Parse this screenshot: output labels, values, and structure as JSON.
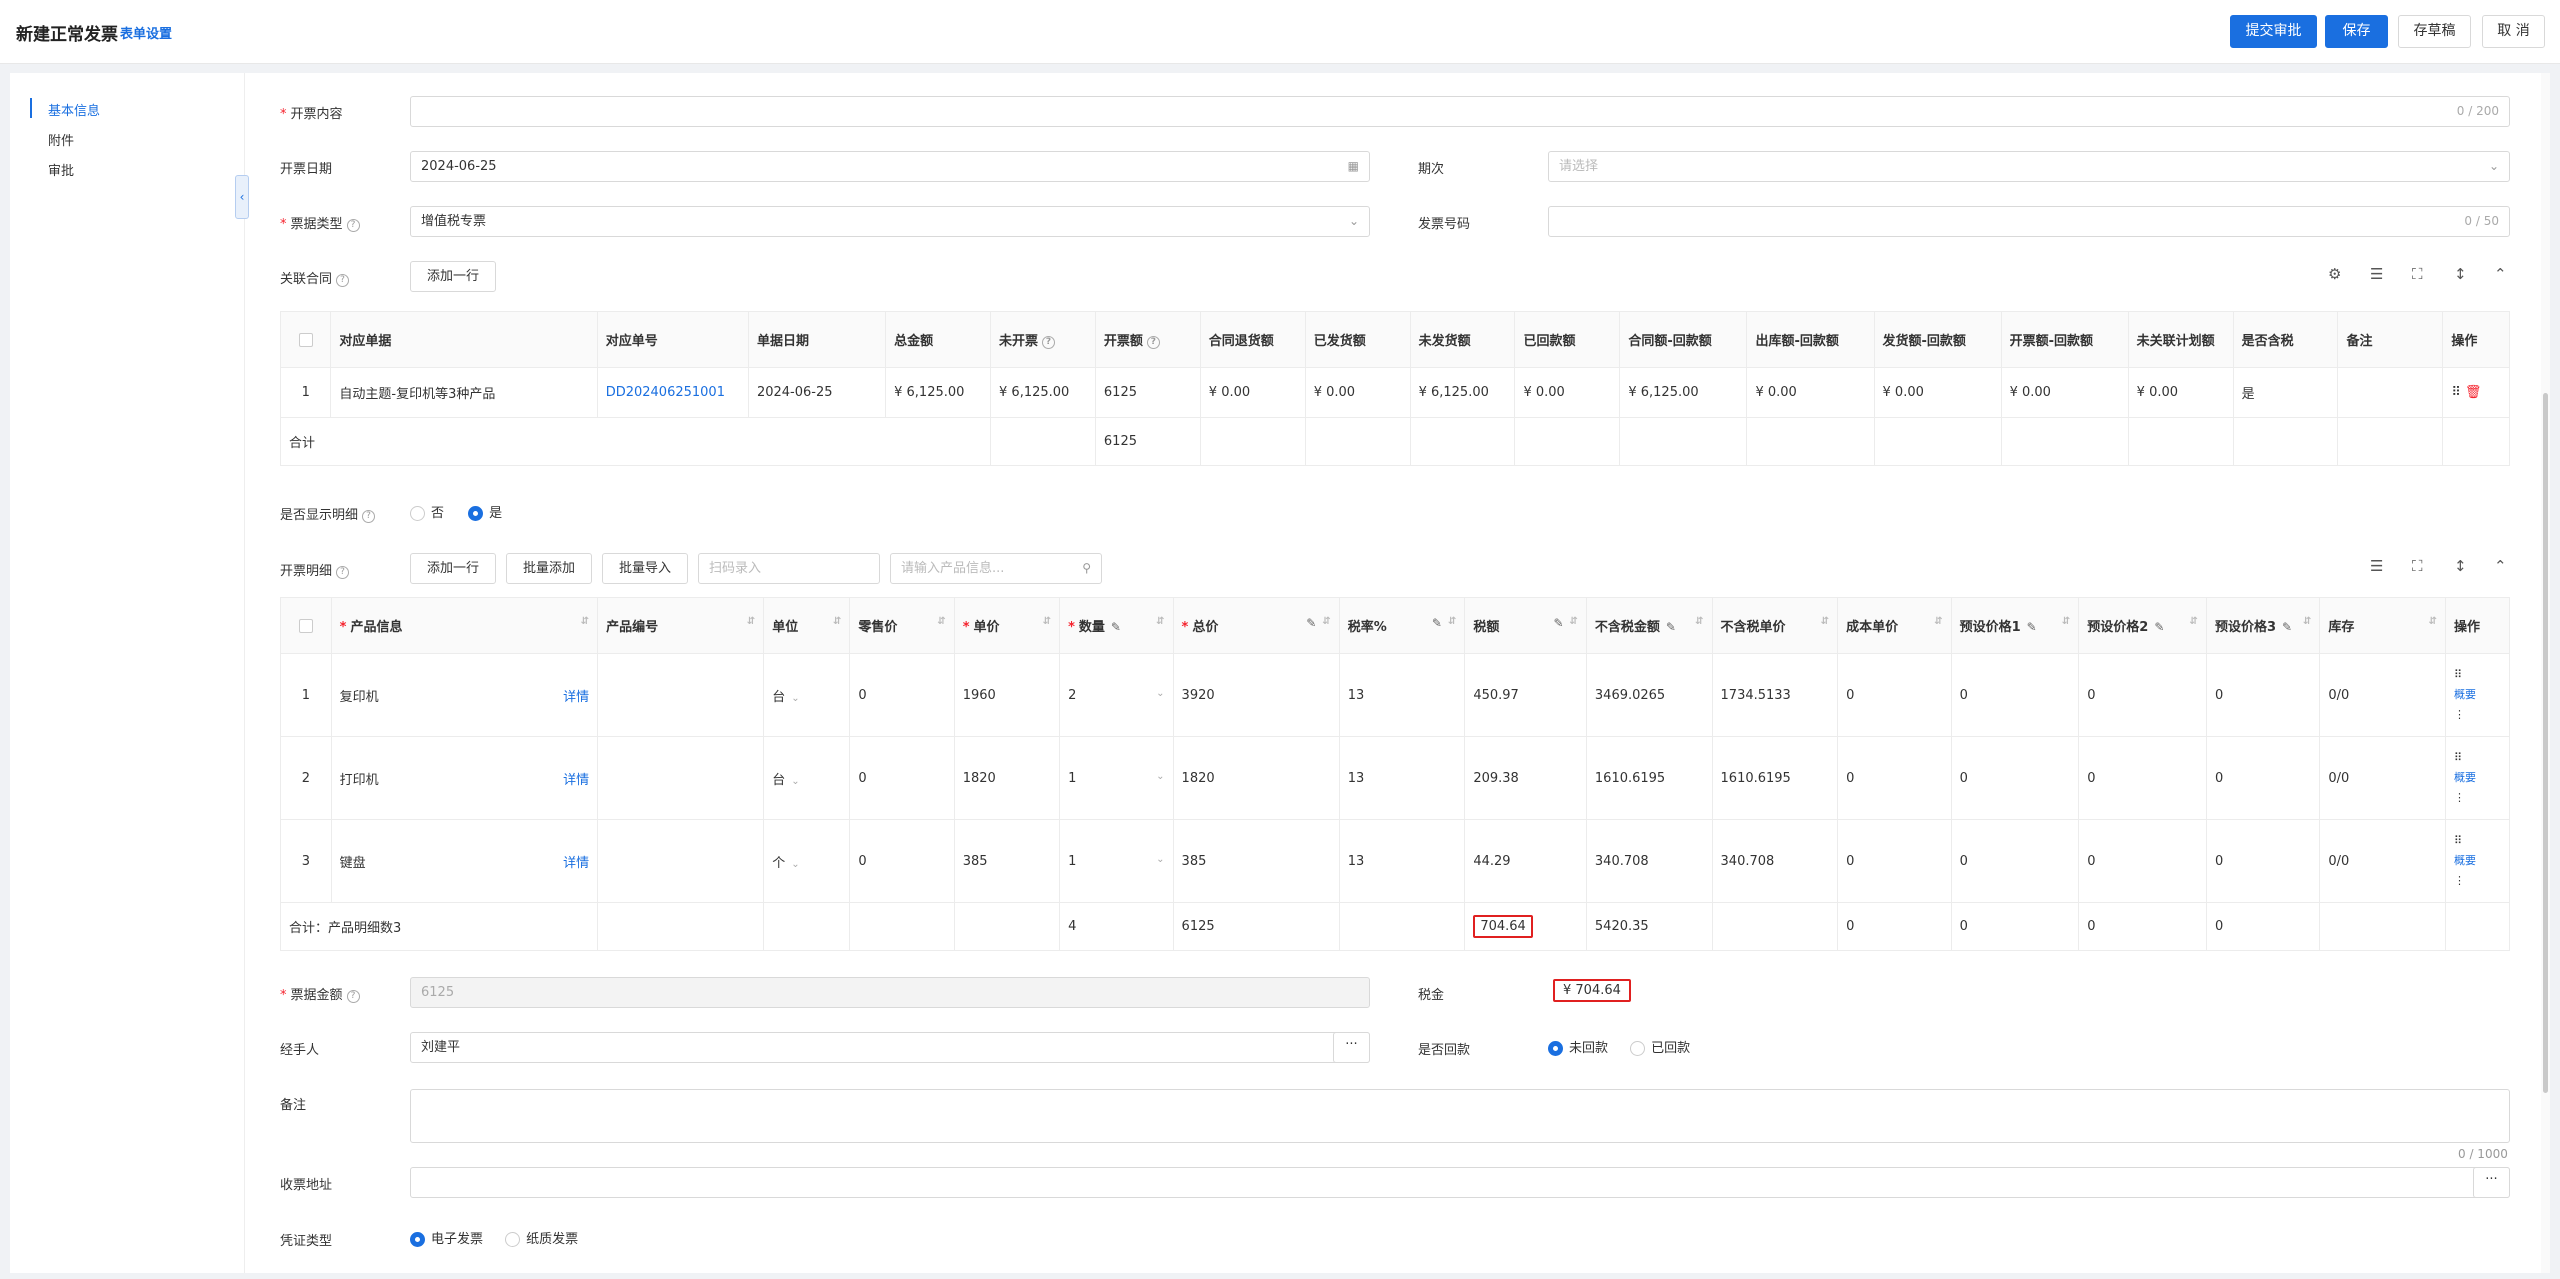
{
  "header": {
    "title": "新建正常发票",
    "form_settings": "表单设置",
    "submit": "提交审批",
    "save": "保存",
    "draft": "存草稿",
    "cancel": "取 消"
  },
  "sidenav": [
    "基本信息",
    "附件",
    "审批"
  ],
  "form": {
    "content_label": "开票内容",
    "content_counter": "0 / 200",
    "date_label": "开票日期",
    "date_value": "2024-06-25",
    "period_label": "期次",
    "period_placeholder": "请选择",
    "type_label": "票据类型",
    "type_value": "增值税专票",
    "invoice_no_label": "发票号码",
    "invoice_no_counter": "0 / 50",
    "contract_label": "关联合同",
    "add_row": "添加一行"
  },
  "contract_table": {
    "headers": [
      "对应单据",
      "对应单号",
      "单据日期",
      "总金额",
      "未开票",
      "开票额",
      "合同退货额",
      "已发货额",
      "未发货额",
      "已回款额",
      "合同额-回款额",
      "出库额-回款额",
      "发货额-回款额",
      "开票额-回款额",
      "未关联计划额",
      "是否含税",
      "备注",
      "操作"
    ],
    "row": {
      "index": "1",
      "doc": "自动主题-复印机等3种产品",
      "doc_no": "DD202406251001",
      "date": "2024-06-25",
      "total": "¥ 6,125.00",
      "uninvoiced": "¥ 6,125.00",
      "invoiced": "6125",
      "returned": "¥ 0.00",
      "shipped": "¥ 0.00",
      "unshipped": "¥ 6,125.00",
      "received": "¥ 0.00",
      "contract_minus_received": "¥ 6,125.00",
      "out_minus_received": "¥ 0.00",
      "ship_minus_received": "¥ 0.00",
      "invoice_minus_received": "¥ 0.00",
      "unlinked_plan": "¥ 0.00",
      "tax_included": "是"
    },
    "sum_label": "合计",
    "sum_invoiced": "6125"
  },
  "show_detail": {
    "label": "是否显示明细",
    "no": "否",
    "yes": "是"
  },
  "detail": {
    "label": "开票明细",
    "add_row": "添加一行",
    "batch_add": "批量添加",
    "batch_import": "批量导入",
    "scan_placeholder": "扫码录入",
    "search_placeholder": "请输入产品信息...",
    "headers": [
      "产品信息",
      "产品编号",
      "单位",
      "零售价",
      "单价",
      "数量",
      "总价",
      "税率%",
      "税额",
      "不含税金额",
      "不含税单价",
      "成本单价",
      "预设价格1",
      "预设价格2",
      "预设价格3",
      "库存",
      "操作"
    ],
    "detail_link": "详情",
    "summary_link": "概要",
    "rows": [
      {
        "index": "1",
        "name": "复印机",
        "unit": "台",
        "retail": "0",
        "price": "1960",
        "qty": "2",
        "total": "3920",
        "tax_rate": "13",
        "tax": "450.97",
        "net": "3469.0265",
        "net_price": "1734.5133",
        "cost": "0",
        "p1": "0",
        "p2": "0",
        "p3": "0",
        "stock": "0/0"
      },
      {
        "index": "2",
        "name": "打印机",
        "unit": "台",
        "retail": "0",
        "price": "1820",
        "qty": "1",
        "total": "1820",
        "tax_rate": "13",
        "tax": "209.38",
        "net": "1610.6195",
        "net_price": "1610.6195",
        "cost": "0",
        "p1": "0",
        "p2": "0",
        "p3": "0",
        "stock": "0/0"
      },
      {
        "index": "3",
        "name": "键盘",
        "unit": "个",
        "retail": "0",
        "price": "385",
        "qty": "1",
        "total": "385",
        "tax_rate": "13",
        "tax": "44.29",
        "net": "340.708",
        "net_price": "340.708",
        "cost": "0",
        "p1": "0",
        "p2": "0",
        "p3": "0",
        "stock": "0/0"
      }
    ],
    "sum": {
      "label": "合计：产品明细数3",
      "qty": "4",
      "total": "6125",
      "tax": "704.64",
      "net": "5420.35",
      "cost": "0",
      "p1": "0",
      "p2": "0",
      "p3": "0"
    }
  },
  "bottom": {
    "amount_label": "票据金额",
    "amount_value": "6125",
    "tax_label": "税金",
    "tax_value": "¥ 704.64",
    "handler_label": "经手人",
    "handler_value": "刘建平",
    "repaid_label": "是否回款",
    "repaid_no": "未回款",
    "repaid_yes": "已回款",
    "remark_label": "备注",
    "remark_counter": "0 / 1000",
    "address_label": "收票地址",
    "voucher_label": "凭证类型",
    "voucher_electronic": "电子发票",
    "voucher_paper": "纸质发票"
  },
  "colors": {
    "primary": "#1a6fe0",
    "required": "#f5222d",
    "highlight_box": "#e02020"
  }
}
